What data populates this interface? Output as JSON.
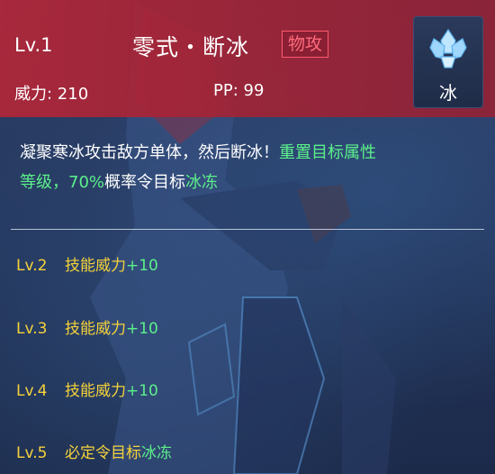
{
  "skill": {
    "level": "Lv.1",
    "name": "零式・断冰",
    "category": "物攻",
    "power_label": "威力: 210",
    "pp_label": "PP: 99",
    "type": "冰"
  },
  "description": {
    "part1": "凝聚寒冰攻击敌方单体，然后断冰！",
    "part2": "重置目标属性",
    "part3": "等级，",
    "part4": "70%",
    "part5": "概率令目标",
    "part6": "冰冻"
  },
  "levels": [
    {
      "lv": "Lv.2",
      "text": "技能威力",
      "bonus": "+10"
    },
    {
      "lv": "Lv.3",
      "text": "技能威力",
      "bonus": "+10"
    },
    {
      "lv": "Lv.4",
      "text": "技能威力",
      "bonus": "+10"
    },
    {
      "lv": "Lv.5",
      "text": "必定令目标",
      "bonus": "冰冻"
    }
  ],
  "colors": {
    "header": "#b22638",
    "accent_green": "#5cf08a",
    "level_yellow": "#f5d23a",
    "category_red": "#ff5a6e"
  },
  "icons": {
    "type_icon": "ice-crystal-icon"
  }
}
